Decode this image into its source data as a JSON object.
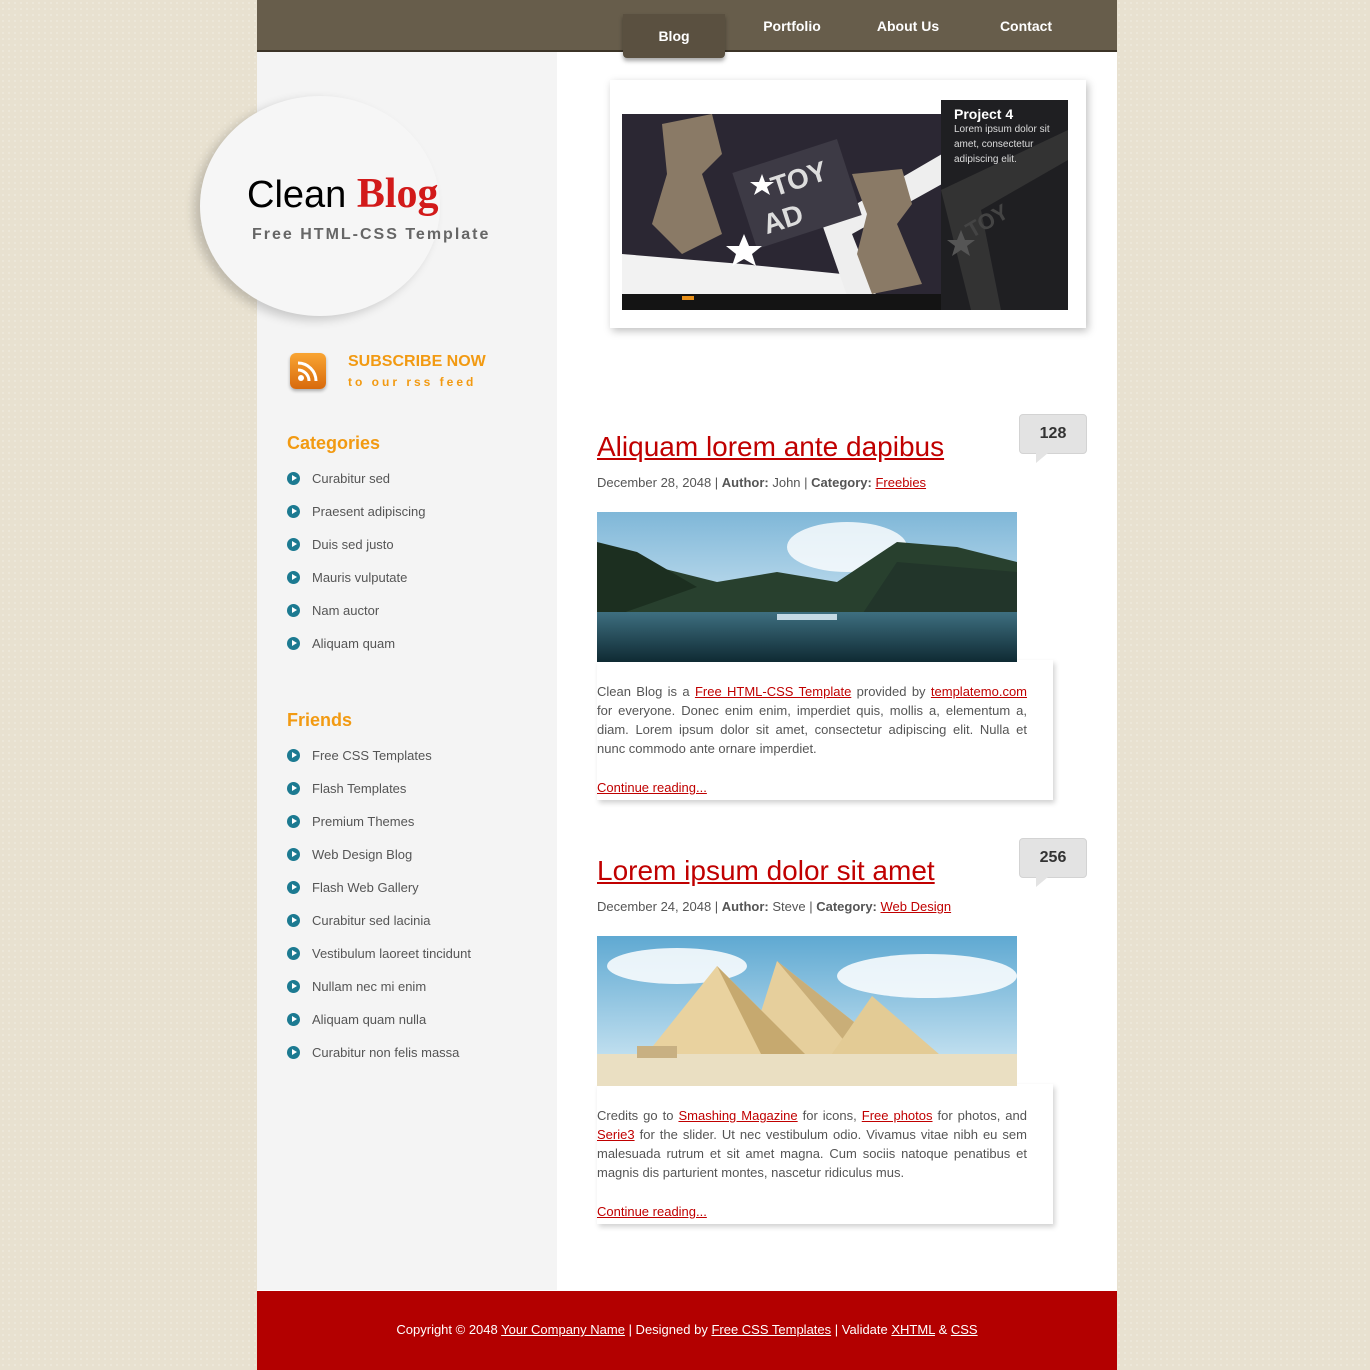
{
  "nav": {
    "items": [
      {
        "label": "Blog",
        "active": true
      },
      {
        "label": "Portfolio",
        "active": false
      },
      {
        "label": "About Us",
        "active": false
      },
      {
        "label": "Contact",
        "active": false
      }
    ]
  },
  "header": {
    "title_part1": "Clean",
    "title_part2": "Blog",
    "slogan": "Free HTML-CSS Template"
  },
  "subscribe": {
    "title": "SUBSCRIBE NOW",
    "subtitle": "to our rss feed",
    "icon": "rss-icon"
  },
  "categories": {
    "heading": "Categories",
    "items": [
      "Curabitur sed",
      "Praesent adipiscing",
      "Duis sed justo",
      "Mauris vulputate",
      "Nam auctor",
      "Aliquam quam"
    ]
  },
  "friends": {
    "heading": "Friends",
    "items": [
      "Free CSS Templates",
      "Flash Templates",
      "Premium Themes",
      "Web Design Blog",
      "Flash Web Gallery",
      "Curabitur sed lacinia",
      "Vestibulum laoreet tincidunt",
      "Nullam nec mi enim",
      "Aliquam quam nulla",
      "Curabitur non felis massa"
    ]
  },
  "banner": {
    "caption_title": "Project 4",
    "caption_text": "Lorem ipsum dolor sit amet, consectetur adipiscing elit.",
    "art_text_1": "TOY",
    "art_text_2": "AD"
  },
  "posts": [
    {
      "title": "Aliquam lorem ante dapibus",
      "date": "December 28, 2048",
      "sep1": " | ",
      "author_label": "Author:",
      "author": " John",
      "sep2": " | ",
      "category_label": "Category:",
      "category": "Freebies",
      "comments": "128",
      "body_1": "Clean Blog is a ",
      "link_1": "Free HTML-CSS Template",
      "body_2": " provided by ",
      "link_2": "templatemo.com",
      "body_3": " for everyone. Donec enim enim, imperdiet quis, mollis a, elementum a, diam. Lorem ipsum dolor sit amet, consectetur adipiscing elit. Nulla et nunc commodo ante ornare imperdiet.",
      "continue": "Continue reading..."
    },
    {
      "title": "Lorem ipsum dolor sit amet",
      "date": "December 24, 2048",
      "sep1": " | ",
      "author_label": "Author:",
      "author": " Steve",
      "sep2": " | ",
      "category_label": "Category:",
      "category": "Web Design",
      "comments": "256",
      "body_1": "Credits go to ",
      "link_1": "Smashing Magazine",
      "body_2": " for icons, ",
      "link_2": "Free photos",
      "body_3": " for photos, and ",
      "link_3": "Serie3",
      "body_4": " for the slider. Ut nec vestibulum odio. Vivamus vitae nibh eu sem malesuada rutrum et sit amet magna. Cum sociis natoque penatibus et magnis dis parturient montes, nascetur ridiculus mus.",
      "continue": "Continue reading..."
    }
  ],
  "footer": {
    "copyright": "Copyright © 2048 ",
    "company": "Your Company Name",
    "designed": " | Designed by ",
    "designer": "Free CSS Templates",
    "validate": " | Validate ",
    "xhtml": "XHTML",
    "amp": " & ",
    "css": "CSS"
  },
  "colors": {
    "accent_red": "#c00000",
    "accent_orange": "#f29a12",
    "nav_bg": "#675d4b",
    "footer_bg": "#b30000",
    "bullet": "#1c7a91"
  }
}
